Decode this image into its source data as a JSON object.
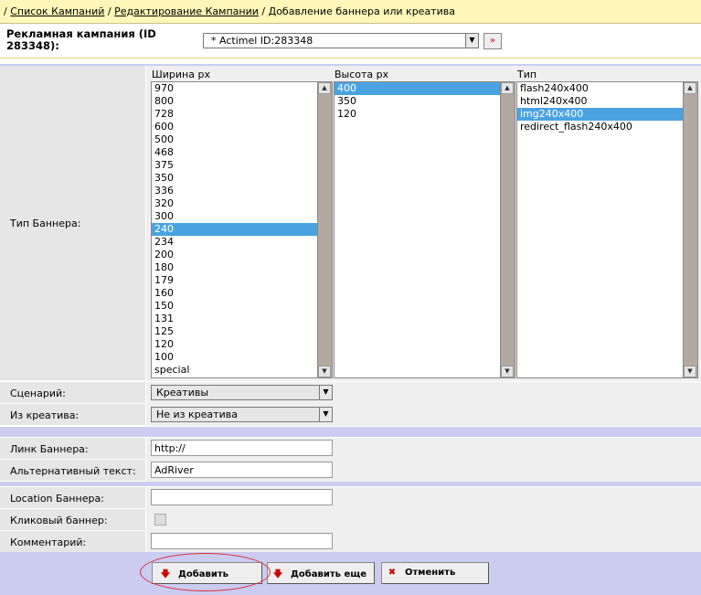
{
  "breadcrumb": {
    "prefix": "/ ",
    "link1": "Список Кампаний",
    "sep1": " / ",
    "link2": "Редактирование Кампании",
    "sep2": " / ",
    "current": "Добавление баннера или креатива"
  },
  "campaign": {
    "label": "Рекламная кампания (ID 283348):",
    "selected": "* Actimel ID:283348",
    "go_icon": "arrow-right-icon"
  },
  "banner_type": {
    "label": "Тип Баннера:",
    "width": {
      "header": "Ширина px",
      "items": [
        "970",
        "800",
        "728",
        "600",
        "500",
        "468",
        "375",
        "350",
        "336",
        "320",
        "300",
        "240",
        "234",
        "200",
        "180",
        "179",
        "160",
        "150",
        "131",
        "125",
        "120",
        "100",
        "special"
      ],
      "selected": "240"
    },
    "height": {
      "header": "Высота px",
      "items": [
        "400",
        "350",
        "120"
      ],
      "selected": "400"
    },
    "type": {
      "header": "Тип",
      "items": [
        "flash240x400",
        "html240x400",
        "img240x400",
        "redirect_flash240x400"
      ],
      "selected": "img240x400"
    }
  },
  "scenario": {
    "label": "Сценарий:",
    "value": "Креативы"
  },
  "from_creative": {
    "label": "Из креатива:",
    "value": "Не из креатива"
  },
  "banner_link": {
    "label": "Линк Баннера:",
    "value": "http://"
  },
  "alt_text": {
    "label": "Альтернативный текст:",
    "value": "AdRiver"
  },
  "location": {
    "label": "Location Баннера:",
    "value": ""
  },
  "clickable": {
    "label": "Кликовый баннер:",
    "checked": false
  },
  "comment": {
    "label": "Комментарий:",
    "value": ""
  },
  "buttons": {
    "add": "Добавить",
    "add_more": "Добавить еще",
    "cancel": "Отменить"
  },
  "colors": {
    "selection": "#4aa3e0",
    "breadcrumb_bg": "#fff7b8",
    "separator": "#ccccf0",
    "highlight": "#d92f3a"
  }
}
